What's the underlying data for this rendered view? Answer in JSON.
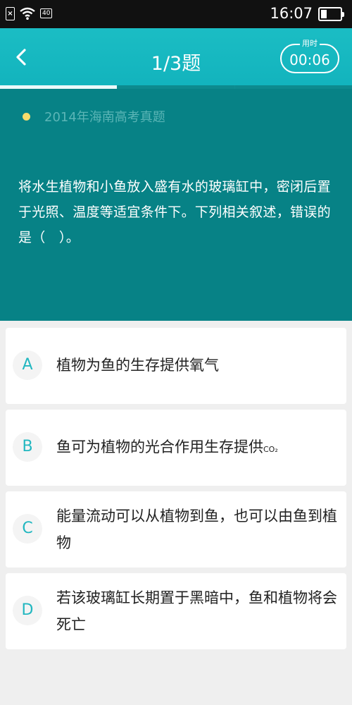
{
  "status_bar": {
    "network": "40",
    "time": "16:07"
  },
  "header": {
    "title": "1/3题",
    "timer_label": "用时",
    "timer_value": "00:06"
  },
  "progress": {
    "current": 1,
    "total": 3
  },
  "question": {
    "source": "2014年海南高考真题",
    "text": "将水生植物和小鱼放入盛有水的玻璃缸中，密闭后置于光照、温度等适宜条件下。下列相关叙述，错误的是（　）。"
  },
  "options": [
    {
      "letter": "A",
      "text": "植物为鱼的生存提供氧气"
    },
    {
      "letter": "B",
      "text": "鱼可为植物的光合作用生存提供",
      "suffix": "CO₂"
    },
    {
      "letter": "C",
      "text": "能量流动可以从植物到鱼，也可以由鱼到植物"
    },
    {
      "letter": "D",
      "text": "若该玻璃缸长期置于黑暗中，鱼和植物将会死亡"
    }
  ],
  "colors": {
    "accent": "#1bbdc4",
    "panel": "#078286",
    "dot": "#f7dc6b"
  }
}
